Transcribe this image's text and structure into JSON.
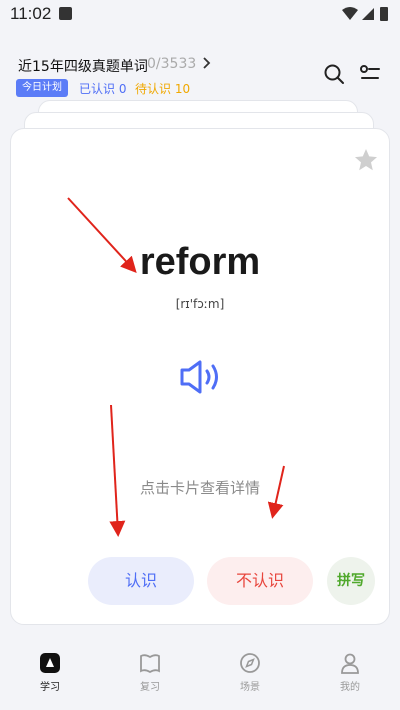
{
  "status_bar": {
    "time": "11:02"
  },
  "header": {
    "book_title": "近15年四级真题单词",
    "progress": "0/3533",
    "today_plan": "今日计划",
    "known": "已认识 0",
    "pending": "待认识 10"
  },
  "card": {
    "word": "reform",
    "phonetic": "[rɪ'fɔːm]",
    "hint": "点击卡片查看详情",
    "know_label": "认识",
    "unknown_label": "不认识",
    "spell_label": "拼写"
  },
  "nav": {
    "items": [
      {
        "label": "学习",
        "icon": "study-icon",
        "active": true
      },
      {
        "label": "复习",
        "icon": "book-icon",
        "active": false
      },
      {
        "label": "场景",
        "icon": "compass-icon",
        "active": false
      },
      {
        "label": "我的",
        "icon": "person-icon",
        "active": false
      }
    ]
  },
  "colors": {
    "accent": "#4f6ef6",
    "warning": "#f0a800",
    "danger": "#e8453c",
    "success": "#4fa82b",
    "annotation": "#e0241b"
  }
}
